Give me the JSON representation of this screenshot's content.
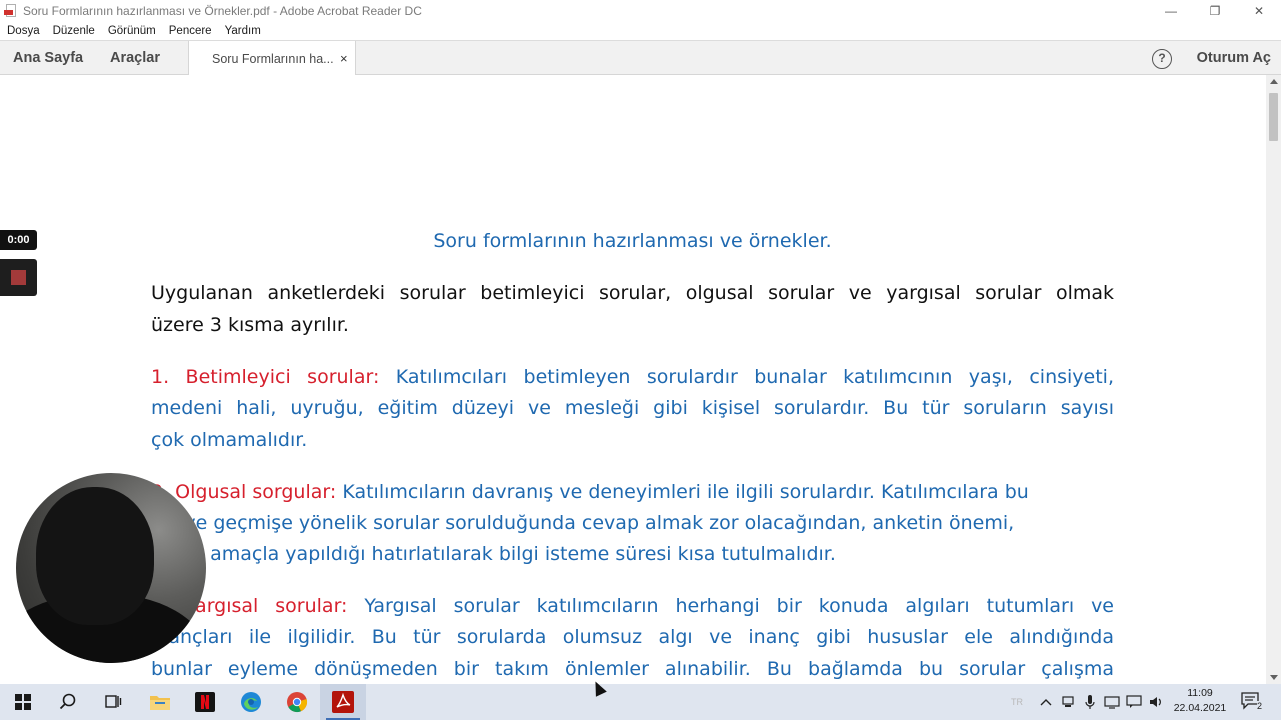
{
  "window": {
    "title": "Soru Formlarının hazırlanması ve Örnekler.pdf - Adobe Acrobat Reader DC",
    "minimize": "—",
    "restore": "❐",
    "close": "✕"
  },
  "menu": [
    "Dosya",
    "Düzenle",
    "Görünüm",
    "Pencere",
    "Yardım"
  ],
  "toolbar": {
    "home": "Ana Sayfa",
    "tools": "Araçlar",
    "doc_tab": "Soru Formlarının ha...",
    "doc_tab_close": "×",
    "help": "?",
    "sign_in": "Oturum Aç"
  },
  "document": {
    "title": "Soru formlarının hazırlanması ve örnekler.",
    "intro": [
      "Uygulanan   anketlerdeki sorular betimleyici sorular, olgusal sorular ve yargısal sorular olmak",
      "üzere 3 kısma ayrılır."
    ],
    "section1": {
      "heading": "1. Betimleyici sorular:",
      "line1": "Katılımcıları betimleyen sorulardır bunalar katılımcının yaşı, cinsiyeti,",
      "line2": "medeni hali, uyruğu, eğitim düzeyi ve mesleği gibi kişisel sorulardır. Bu tür soruların sayısı",
      "line3": "çok olmamalıdır."
    },
    "section2": {
      "heading": "2. Olgusal sorgular:",
      "line1": "Katılımcıların davranış ve deneyimleri ile ilgili sorulardır. Katılımcılara bu",
      "line2": "tür ve  geçmişe yönelik sorular sorulduğunda cevap almak zor olacağından, anketin önemi,",
      "line3": "hangi amaçla yapıldığı hatırlatılarak bilgi isteme  süresi kısa tutulmalıdır."
    },
    "section3": {
      "heading": "3. Yargısal sorular:",
      "line1": "Yargısal sorular katılımcıların herhangi bir konuda algıları tutumları ve",
      "line2": "inançları ile ilgilidir. Bu tür sorularda  olumsuz algı ve inanç gibi hususlar ele alındığında",
      "line3": "bunlar eyleme dönüşmeden bir takım önlemler alınabilir. Bu bağlamda bu sorular çalışma"
    }
  },
  "recorder": {
    "timer": "0:00"
  },
  "taskbar": {
    "language": "TR",
    "time": "11:09",
    "date": "22.04.2021",
    "notifications": "2"
  },
  "colors": {
    "doc_blue": "#1f69b0",
    "doc_red": "#d6202d",
    "acrobat_red": "#b3140b",
    "taskbar_bg": "#dfe5ef"
  }
}
